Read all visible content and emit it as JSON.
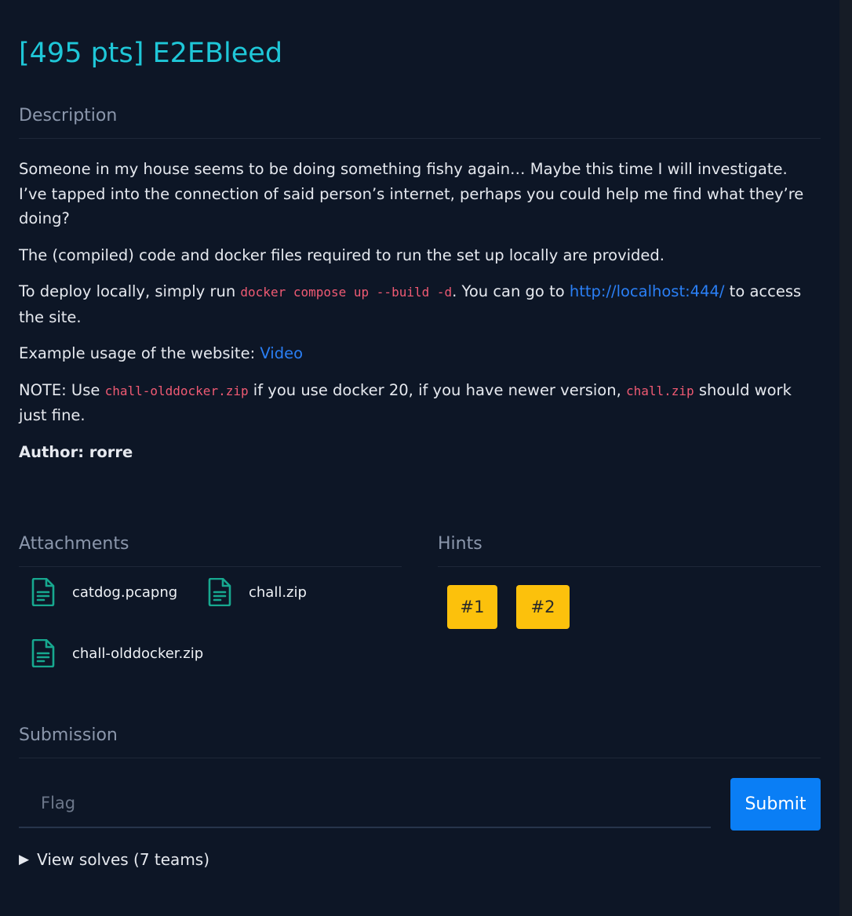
{
  "challenge": {
    "title": "[495 pts] E2EBleed"
  },
  "description": {
    "heading": "Description",
    "para1": "Someone in my house seems to be doing something fishy again… Maybe this time I will investigate. I’ve tapped into the connection of said person’s internet, perhaps you could help me find what they’re doing?",
    "para2": "The (compiled) code and docker files required to run the set up locally are provided.",
    "para3_before": "To deploy locally, simply run ",
    "para3_code": "docker compose up --build -d",
    "para3_middle": ". You can go to ",
    "para3_link": "http://localhost:444/",
    "para3_after": " to access the site.",
    "para4_before": "Example usage of the website: ",
    "para4_link": "Video",
    "para5_before": "NOTE: Use ",
    "para5_code1": "chall-olddocker.zip",
    "para5_middle": " if you use docker 20, if you have newer version, ",
    "para5_code2": "chall.zip",
    "para5_after": " should work just fine.",
    "author": "Author: rorre"
  },
  "attachments": {
    "heading": "Attachments",
    "files": [
      {
        "name": "catdog.pcapng",
        "icon": "file-icon"
      },
      {
        "name": "chall.zip",
        "icon": "file-icon"
      },
      {
        "name": "chall-olddocker.zip",
        "icon": "file-icon"
      }
    ]
  },
  "hints": {
    "heading": "Hints",
    "items": [
      "#1",
      "#2"
    ]
  },
  "submission": {
    "heading": "Submission",
    "flag_placeholder": "Flag",
    "flag_value": "",
    "submit_label": "Submit",
    "solves_label": "View solves (7 teams)",
    "solves_icon": "triangle-right-icon"
  },
  "colors": {
    "background": "#0d1626",
    "title": "#1fc7d8",
    "heading": "#8b97ac",
    "code": "#ef5a73",
    "link": "#2a7ff5",
    "file_icon": "#17a88f",
    "hint_button": "#fcc10c",
    "submit_button": "#0a7ef5"
  }
}
